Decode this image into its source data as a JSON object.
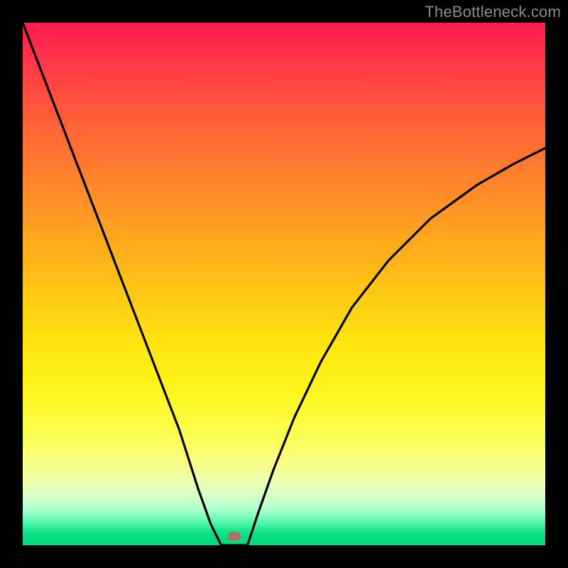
{
  "watermark": {
    "text": "TheBottleneck.com"
  },
  "marker": {
    "x_frac": 0.405,
    "y_frac": 0.982
  },
  "chart_data": {
    "type": "line",
    "title": "",
    "xlabel": "",
    "ylabel": "",
    "xlim": [
      0,
      1
    ],
    "ylim": [
      0,
      1
    ],
    "series": [
      {
        "name": "bottleneck-curve-left",
        "x": [
          0.0,
          0.05,
          0.1,
          0.15,
          0.2,
          0.25,
          0.3,
          0.335,
          0.36,
          0.38
        ],
        "values": [
          1.0,
          0.87,
          0.74,
          0.61,
          0.48,
          0.35,
          0.22,
          0.11,
          0.04,
          0.0
        ]
      },
      {
        "name": "bottleneck-curve-flat",
        "x": [
          0.38,
          0.43
        ],
        "values": [
          0.0,
          0.0
        ]
      },
      {
        "name": "bottleneck-curve-right",
        "x": [
          0.43,
          0.45,
          0.48,
          0.52,
          0.57,
          0.63,
          0.7,
          0.78,
          0.87,
          0.94,
          1.0
        ],
        "values": [
          0.0,
          0.06,
          0.145,
          0.245,
          0.35,
          0.455,
          0.545,
          0.625,
          0.69,
          0.73,
          0.76
        ]
      }
    ],
    "annotations": [
      {
        "name": "optimal-marker",
        "x": 0.405,
        "y": 0.018
      }
    ]
  }
}
